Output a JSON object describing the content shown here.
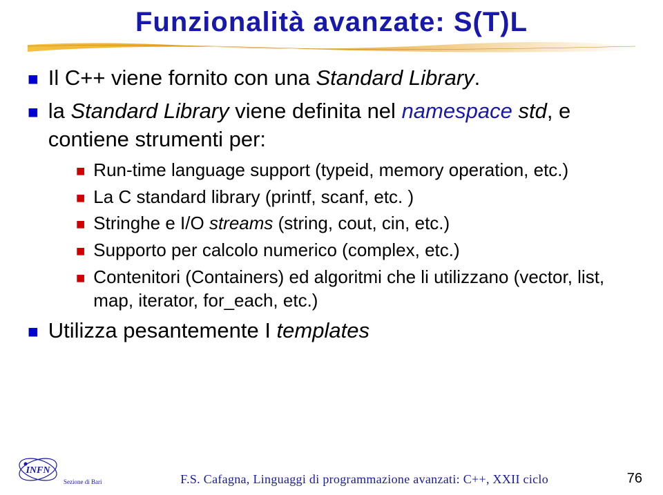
{
  "title": "Funzionalità avanzate: S(T)L",
  "bullets": [
    {
      "prefix": "Il C++ viene fornito con una ",
      "italic": "Standard Library",
      "suffix": "."
    },
    {
      "prefix": "la ",
      "italic1": "Standard Library",
      "mid1": " viene definita nel ",
      "ns": "namespace",
      "mid2_italic": " std",
      "suffix": ", e contiene strumenti per:"
    }
  ],
  "sub": [
    "Run-time language support (typeid, memory operation, etc.)",
    "La C standard library (printf, scanf, etc. )"
  ],
  "sub_stream": {
    "pre": "Stringhe e I/O ",
    "it": "streams",
    "post": " (string, cout, cin, etc.)"
  },
  "sub2": [
    "Supporto per calcolo numerico (complex, etc.)",
    "Contenitori (Containers) ed algoritmi che li utilizzano (vector, list, map, iterator, for_each, etc.)"
  ],
  "bullet3": {
    "pre": "Utilizza pesantemente I ",
    "it": "templates"
  },
  "footer": {
    "sezione": "Sezione di Bari",
    "text": "F.S. Cafagna, Linguaggi di programmazione avanzati: C++, XXII ciclo",
    "page": "76",
    "logo_label": "INFN"
  }
}
